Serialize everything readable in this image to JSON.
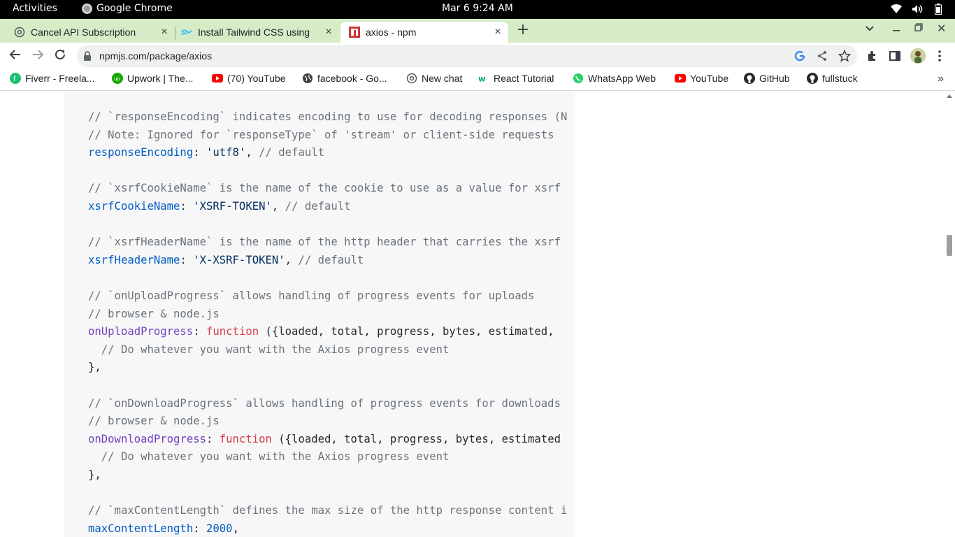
{
  "system_bar": {
    "activities": "Activities",
    "app_name": "Google Chrome",
    "datetime": "Mar 6  9:24 AM"
  },
  "tabs": [
    {
      "label": "Cancel API Subscription",
      "icon": "openai-icon"
    },
    {
      "label": "Install Tailwind CSS using",
      "icon": "tailwind-icon"
    },
    {
      "label": "axios - npm",
      "icon": "npm-icon",
      "active": true
    }
  ],
  "toolbar": {
    "url": "npmjs.com/package/axios"
  },
  "bookmarks": [
    {
      "label": "Fiverr - Freela...",
      "icon": "fiverr-icon"
    },
    {
      "label": "Upwork | The...",
      "icon": "upwork-icon"
    },
    {
      "label": "(70) YouTube",
      "icon": "youtube-icon"
    },
    {
      "label": "facebook - Go...",
      "icon": "globe-icon"
    },
    {
      "label": "New chat",
      "icon": "openai-icon"
    },
    {
      "label": "React Tutorial",
      "icon": "w3schools-icon"
    },
    {
      "label": "WhatsApp Web",
      "icon": "whatsapp-icon"
    },
    {
      "label": "YouTube",
      "icon": "youtube-icon"
    },
    {
      "label": "GitHub",
      "icon": "github-icon"
    },
    {
      "label": "fullstuck",
      "icon": "github-icon"
    }
  ],
  "code": {
    "lines": [
      [
        {
          "t": "// `responseEncoding` indicates encoding to use for decoding responses (N",
          "c": "c"
        }
      ],
      [
        {
          "t": "// Note: Ignored for `responseType` of 'stream' or client-side requests",
          "c": "c"
        }
      ],
      [
        {
          "t": "responseEncoding",
          "c": "p"
        },
        {
          "t": ": ",
          "c": ""
        },
        {
          "t": "'utf8'",
          "c": "s"
        },
        {
          "t": ", ",
          "c": ""
        },
        {
          "t": "// default",
          "c": "c"
        }
      ],
      [],
      [
        {
          "t": "// `xsrfCookieName` is the name of the cookie to use as a value for xsrf",
          "c": "c"
        }
      ],
      [
        {
          "t": "xsrfCookieName",
          "c": "p"
        },
        {
          "t": ": ",
          "c": ""
        },
        {
          "t": "'XSRF-TOKEN'",
          "c": "s"
        },
        {
          "t": ", ",
          "c": ""
        },
        {
          "t": "// default",
          "c": "c"
        }
      ],
      [],
      [
        {
          "t": "// `xsrfHeaderName` is the name of the http header that carries the xsrf",
          "c": "c"
        }
      ],
      [
        {
          "t": "xsrfHeaderName",
          "c": "p"
        },
        {
          "t": ": ",
          "c": ""
        },
        {
          "t": "'X-XSRF-TOKEN'",
          "c": "s"
        },
        {
          "t": ", ",
          "c": ""
        },
        {
          "t": "// default",
          "c": "c"
        }
      ],
      [],
      [
        {
          "t": "// `onUploadProgress` allows handling of progress events for uploads",
          "c": "c"
        }
      ],
      [
        {
          "t": "// browser & node.js",
          "c": "c"
        }
      ],
      [
        {
          "t": "onUploadProgress",
          "c": "pu"
        },
        {
          "t": ": ",
          "c": ""
        },
        {
          "t": "function",
          "c": "k"
        },
        {
          "t": " ({loaded, total, progress, bytes, estimated,",
          "c": ""
        }
      ],
      [
        {
          "t": "  // Do whatever you want with the Axios progress event",
          "c": "c"
        }
      ],
      [
        {
          "t": "},",
          "c": ""
        }
      ],
      [],
      [
        {
          "t": "// `onDownloadProgress` allows handling of progress events for downloads",
          "c": "c"
        }
      ],
      [
        {
          "t": "// browser & node.js",
          "c": "c"
        }
      ],
      [
        {
          "t": "onDownloadProgress",
          "c": "pu"
        },
        {
          "t": ": ",
          "c": ""
        },
        {
          "t": "function",
          "c": "k"
        },
        {
          "t": " ({loaded, total, progress, bytes, estimated",
          "c": ""
        }
      ],
      [
        {
          "t": "  // Do whatever you want with the Axios progress event",
          "c": "c"
        }
      ],
      [
        {
          "t": "},",
          "c": ""
        }
      ],
      [],
      [
        {
          "t": "// `maxContentLength` defines the max size of the http response content i",
          "c": "c"
        }
      ],
      [
        {
          "t": "maxContentLength",
          "c": "p"
        },
        {
          "t": ": ",
          "c": ""
        },
        {
          "t": "2000",
          "c": "n"
        },
        {
          "t": ",",
          "c": ""
        }
      ]
    ]
  },
  "colors": {
    "tabstrip_bg": "#d5ecc7",
    "code_bg": "#f7f7f7",
    "comment": "#6a737d",
    "property": "#005cc5",
    "method_property": "#6f42c1",
    "string": "#032f62",
    "keyword": "#d73a49"
  }
}
